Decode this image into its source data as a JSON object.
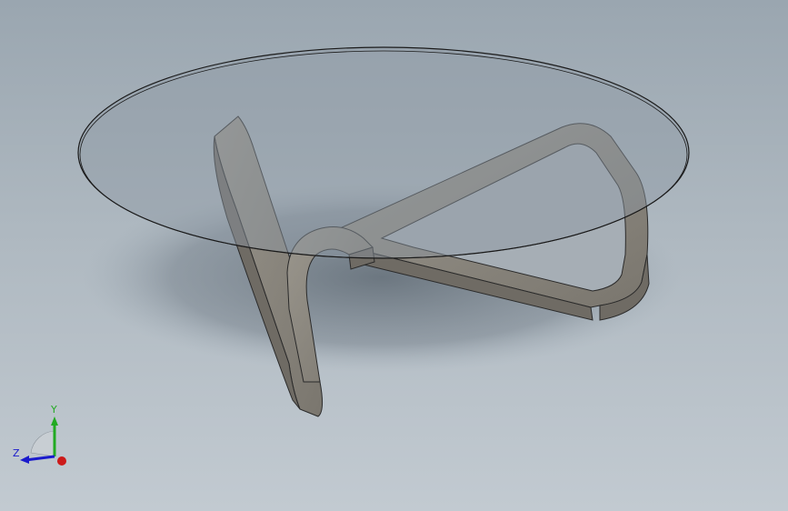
{
  "viewport": {
    "model": "glass-top-coffee-table",
    "colors": {
      "background_top": "#9aa6b0",
      "background_bottom": "#c2cad1",
      "frame_fill": "#8c8880",
      "frame_dark": "#6f6b64",
      "frame_edge": "#2a2a2a",
      "glass_fill": "#8f9aa3",
      "glass_edge": "#1a1a1a",
      "shadow": "#55606a"
    }
  },
  "triad": {
    "axes": {
      "y_label": "Y",
      "z_label": "Z"
    },
    "colors": {
      "y": "#22aa22",
      "z": "#1a1acc",
      "x": "#cc1a1a"
    },
    "icons": [
      "y-axis-arrow-icon",
      "z-axis-arrow-icon",
      "x-axis-origin-icon"
    ]
  }
}
